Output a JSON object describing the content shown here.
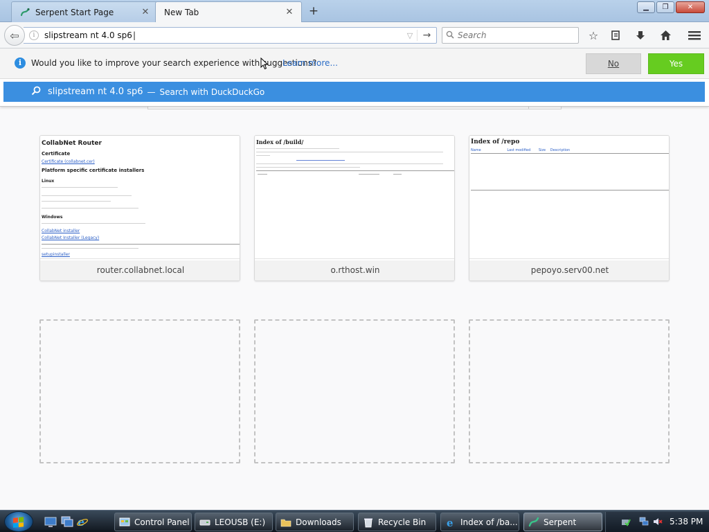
{
  "browser": {
    "tabs": [
      {
        "title": "Serpent Start Page",
        "active": false
      },
      {
        "title": "New Tab",
        "active": true
      }
    ],
    "new_tab_symbol": "+",
    "window_controls": [
      "minimize",
      "maximize",
      "close"
    ]
  },
  "navbar": {
    "url_value": "slipstream nt 4.0 sp6",
    "search_placeholder": "Search"
  },
  "suggestion_bar": {
    "message": "Would you like to improve your search experience with suggestions?",
    "learn_more": "Learn more...",
    "no_label": "No",
    "yes_label": "Yes"
  },
  "search_result": {
    "query": "slipstream nt 4.0 sp6",
    "separator": "—",
    "engine_text": "Search with DuckDuckGo"
  },
  "top_sites": [
    {
      "label": "router.collabnet.local",
      "thumb": {
        "heading": "CollabNet Router",
        "sections": [
          "Certificate",
          "Platform specific certificate installers",
          "Linux",
          "Windows"
        ],
        "links": [
          "Certificate (collabnet.cer)",
          "CollabNet installer",
          "CollabNet Installer (Legacy)",
          "setupinstaller"
        ]
      }
    },
    {
      "label": "o.rthost.win",
      "thumb": {
        "heading": "Index of /build/"
      }
    },
    {
      "label": "pepoyo.serv00.net",
      "thumb": {
        "heading": "Index of /repo",
        "columns": [
          "Name",
          "Last modified",
          "Size",
          "Description"
        ]
      }
    }
  ],
  "empty_tiles": 3,
  "taskbar": {
    "items": [
      {
        "label": "Control Panel",
        "active": false
      },
      {
        "label": "LEOUSB (E:)",
        "active": false
      },
      {
        "label": "Downloads",
        "active": false
      },
      {
        "label": "Recycle Bin",
        "active": false
      },
      {
        "label": "Index of /ba...",
        "active": false
      },
      {
        "label": "Serpent",
        "active": true
      }
    ],
    "clock": "5:38 PM"
  },
  "colors": {
    "accent_blue": "#3b8fe0",
    "yes_green": "#66cc20",
    "link_blue": "#2a6cc6"
  }
}
